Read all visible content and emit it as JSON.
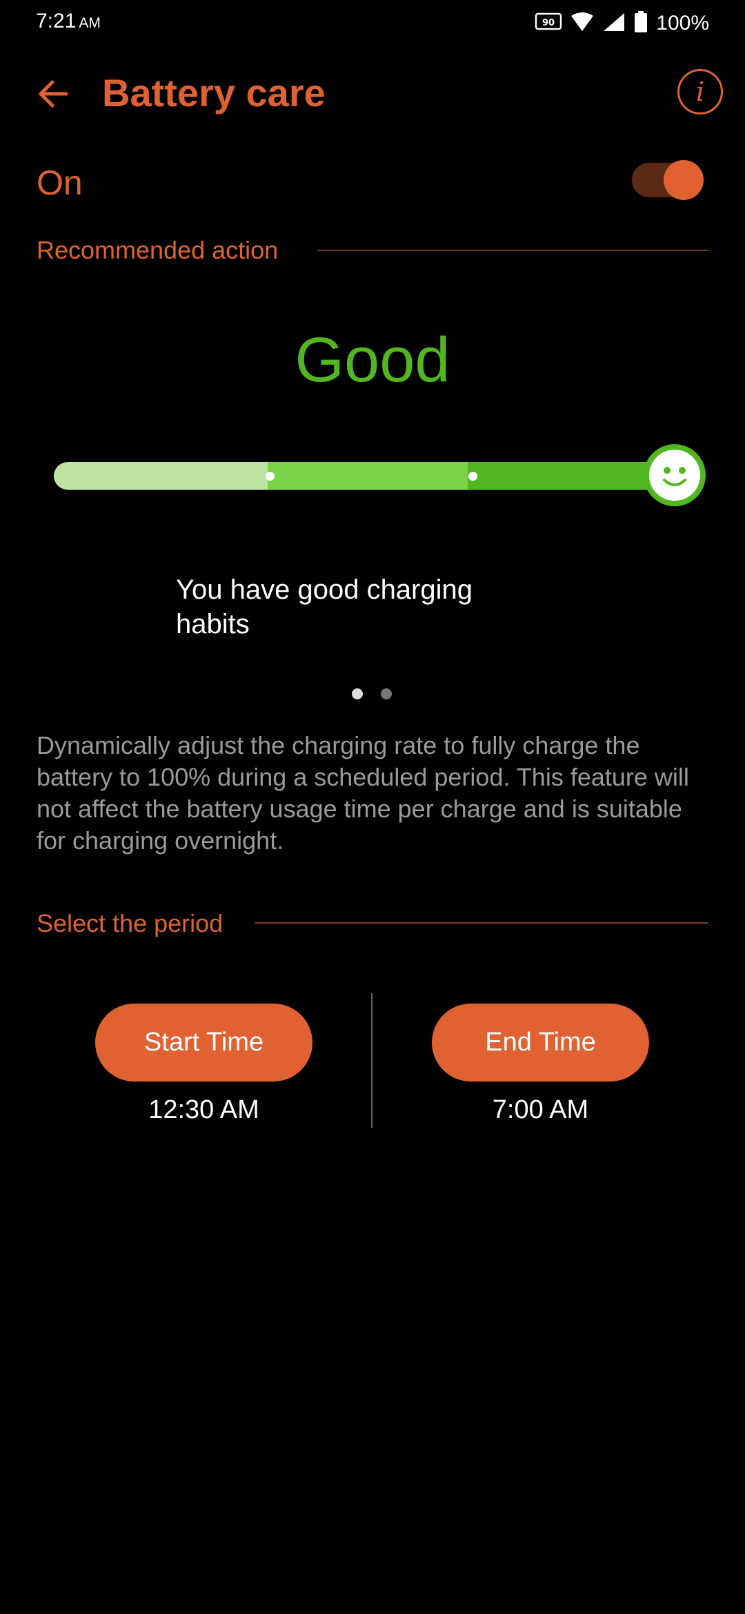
{
  "status_bar": {
    "time": "7:21",
    "ampm": "AM",
    "refresh_badge": "90",
    "battery": "100%",
    "icons": [
      "refresh-rate-icon",
      "wifi-icon",
      "signal-icon",
      "battery-icon"
    ]
  },
  "app_bar": {
    "title": "Battery care",
    "back_icon": "arrow-left-icon",
    "info_icon": "info-icon",
    "info_glyph": "i"
  },
  "toggle": {
    "label": "On",
    "state": true
  },
  "recommended": {
    "header": "Recommended action",
    "rating": "Good",
    "level_index": 3,
    "level_total": 3,
    "message": "You have good charging habits",
    "page_index": 1,
    "page_count": 2
  },
  "description": "Dynamically adjust the charging rate to fully charge the battery to 100% during a scheduled period. This feature will not affect the battery usage time per charge and is suitable for charging overnight.",
  "period": {
    "header": "Select the period",
    "start_label": "Start Time",
    "start_value": "12:30 AM",
    "end_label": "End Time",
    "end_value": "7:00 AM"
  },
  "colors": {
    "accent": "#E06233",
    "good_green": "#52B621",
    "light_green": "#BFE3A3",
    "mid_green": "#7AD34A",
    "description_gray": "#9a9a9a"
  }
}
